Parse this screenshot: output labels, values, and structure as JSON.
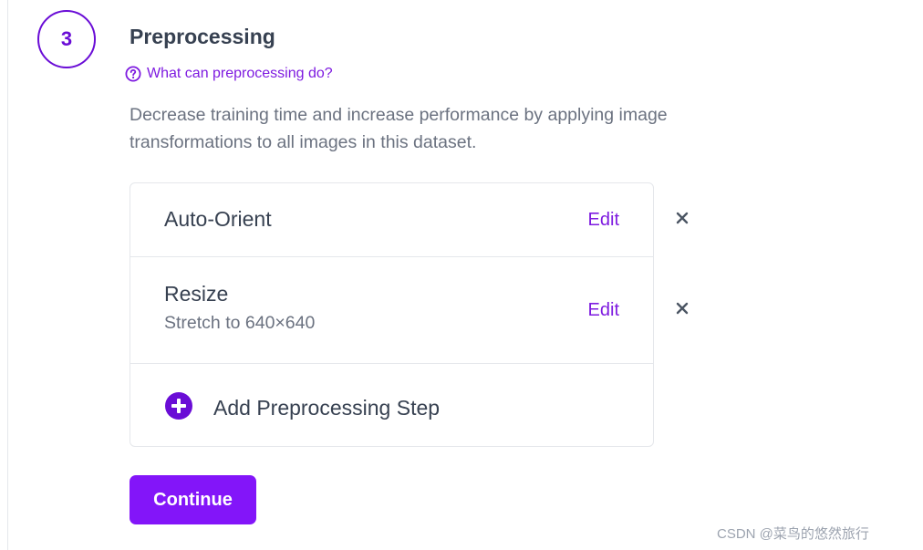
{
  "step": {
    "number": "3",
    "title": "Preprocessing",
    "help_link": "What can preprocessing do?",
    "description": "Decrease training time and increase performance by applying image transformations to all images in this dataset."
  },
  "steps_list": {
    "items": [
      {
        "name": "Auto-Orient",
        "subtitle": "",
        "edit_label": "Edit"
      },
      {
        "name": "Resize",
        "subtitle": "Stretch to 640×640",
        "edit_label": "Edit"
      }
    ],
    "add_label": "Add Preprocessing Step"
  },
  "continue_label": "Continue",
  "watermark": "CSDN @菜鸟的悠然旅行",
  "icons": {
    "help": "question-circle-icon",
    "remove": "close-icon",
    "add": "plus-circle-icon"
  },
  "colors": {
    "accent": "#8315f9",
    "link": "#7e1be0",
    "text": "#374151",
    "muted": "#6b7280"
  }
}
